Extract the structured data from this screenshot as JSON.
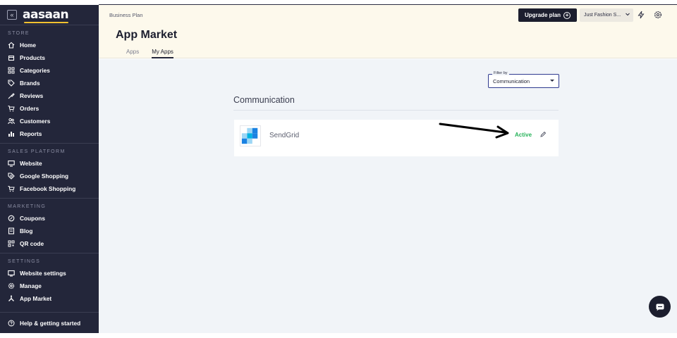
{
  "sidebar": {
    "brand": "aasaan",
    "collapse_glyph": "«",
    "sections": [
      {
        "label": "STORE",
        "items": [
          {
            "label": "Home",
            "icon": "home-icon"
          },
          {
            "label": "Products",
            "icon": "box-icon"
          },
          {
            "label": "Categories",
            "icon": "grid-icon"
          },
          {
            "label": "Brands",
            "icon": "tag-icon"
          },
          {
            "label": "Reviews",
            "icon": "thumbs-up-icon"
          },
          {
            "label": "Orders",
            "icon": "cart-icon"
          },
          {
            "label": "Customers",
            "icon": "users-icon"
          },
          {
            "label": "Reports",
            "icon": "bar-chart-icon"
          }
        ]
      },
      {
        "label": "SALES PLATFORM",
        "items": [
          {
            "label": "Website",
            "icon": "monitor-icon"
          },
          {
            "label": "Google Shopping",
            "icon": "google-tag-icon"
          },
          {
            "label": "Facebook Shopping",
            "icon": "facebook-cart-icon"
          }
        ]
      },
      {
        "label": "MARKETING",
        "items": [
          {
            "label": "Coupons",
            "icon": "coupon-icon"
          },
          {
            "label": "Blog",
            "icon": "blog-icon"
          },
          {
            "label": "QR code",
            "icon": "qr-icon"
          }
        ]
      },
      {
        "label": "SETTINGS",
        "items": [
          {
            "label": "Website settings",
            "icon": "settings-sliders-icon"
          },
          {
            "label": "Manage",
            "icon": "gear-icon"
          },
          {
            "label": "App Market",
            "icon": "apps-icon"
          }
        ]
      }
    ],
    "help_label": "Help & getting started"
  },
  "header": {
    "plan": "Business Plan",
    "title": "App Market",
    "tabs": [
      {
        "label": "Apps",
        "active": false
      },
      {
        "label": "My Apps",
        "active": true
      }
    ],
    "upgrade_label": "Upgrade plan",
    "store_name": "Just Fashion S..."
  },
  "main": {
    "filter": {
      "label": "Filter by",
      "value": "Communication"
    },
    "section_title": "Communication",
    "apps": [
      {
        "name": "SendGrid",
        "status": "Active"
      }
    ]
  },
  "colors": {
    "sidebar_bg": "#23263a",
    "header_bg": "#fdf9ec",
    "main_bg": "#f1f4f8",
    "active_green": "#27b35a",
    "accent_blue": "#2f3a8f",
    "brand_yellow": "#f2c230"
  }
}
